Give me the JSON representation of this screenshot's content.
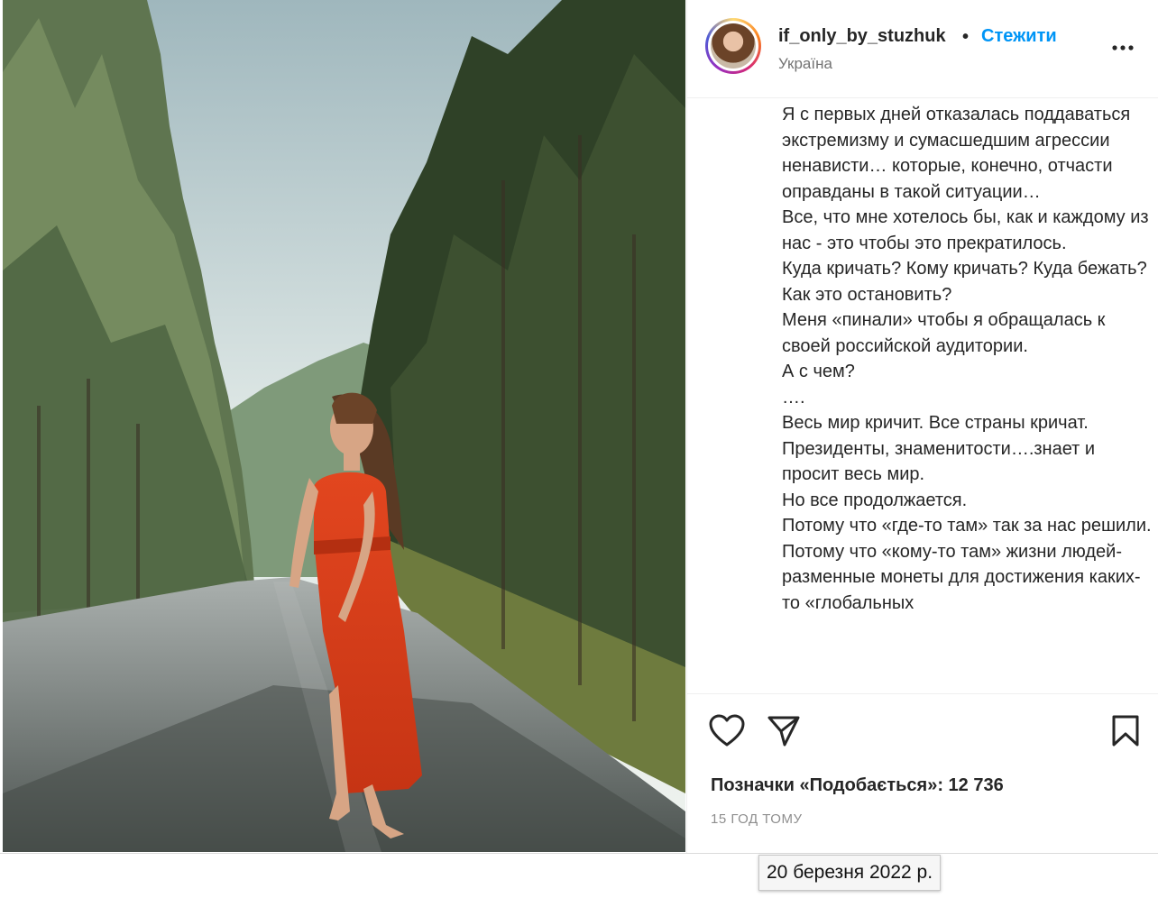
{
  "header": {
    "username": "if_only_by_stuzhuk",
    "separator": "•",
    "follow_label": "Стежити",
    "location": "Україна"
  },
  "caption": {
    "text": "Я с первых дней отказалась поддаваться экстремизму и сумасшедшим агрессии ненависти… которые, конечно, отчасти оправданы в такой ситуации…\nВсе, что мне хотелось бы, как и каждому из нас - это чтобы это прекратилось.\nКуда кричать? Кому кричать? Куда бежать? Как это остановить?\nМеня «пинали» чтобы я обращалась к своей российской аудитории.\nА с чем?\n….\nВесь мир кричит. Все страны кричат.\nПрезиденты, знаменитости….знает и просит весь мир.\nНо все продолжается.\nПотому что «где-то там» так за нас решили.\nПотому что «кому-то там» жизни людей- разменные монеты для достижения каких-то «глобальных"
  },
  "actions": {
    "like_icon": "heart-icon",
    "share_icon": "paper-plane-icon",
    "save_icon": "bookmark-icon"
  },
  "likes_text": "Позначки «Подобається»: 12 736",
  "timestamp": "15 ГОД ТОМУ",
  "tooltip": "20 березня 2022 р.",
  "colors": {
    "follow": "#0095f6",
    "text": "#262626",
    "secondary": "#737373"
  }
}
